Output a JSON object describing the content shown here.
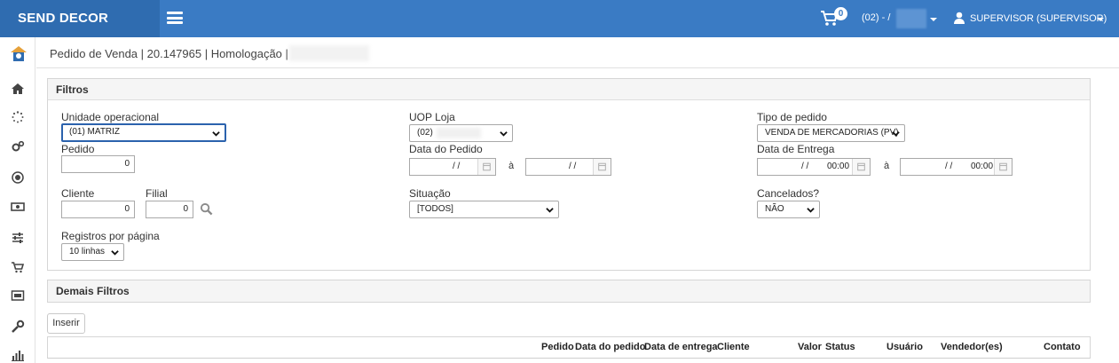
{
  "app": {
    "brand": "SEND DECOR",
    "cart_count": "0",
    "store": "(02) - /",
    "user": "SUPERVISOR (SUPERVISOR)"
  },
  "breadcrumb": "Pedido de Venda | 20.147965 | Homologação |",
  "filters": {
    "title": "Filtros",
    "unidade_label": "Unidade operacional",
    "unidade_value": "(01) MATRIZ",
    "uop_label": "UOP Loja",
    "uop_value": "(02)",
    "tipo_label": "Tipo de pedido",
    "tipo_value": "VENDA DE MERCADORIAS (PV)",
    "pedido_label": "Pedido",
    "pedido_value": "0",
    "data_pedido_label": "Data do Pedido",
    "data_entrega_label": "Data de Entrega",
    "date_slashes": "/ /",
    "time_value": "00:00",
    "range_sep": "à",
    "cliente_label": "Cliente",
    "cliente_value": "0",
    "filial_label": "Filial",
    "filial_value": "0",
    "situacao_label": "Situação",
    "situacao_value": "[TODOS]",
    "cancelados_label": "Cancelados?",
    "cancelados_value": "NÃO",
    "registros_label": "Registros por página",
    "registros_value": "10 linhas"
  },
  "demais": {
    "title": "Demais Filtros"
  },
  "actions": {
    "inserir": "Inserir"
  },
  "table": {
    "columns": [
      "Pedido",
      "Data do pedido",
      "Data de entrega",
      "Cliente",
      "Valor",
      "Status",
      "Usuário",
      "Vendedor(es)",
      "Contato"
    ]
  }
}
